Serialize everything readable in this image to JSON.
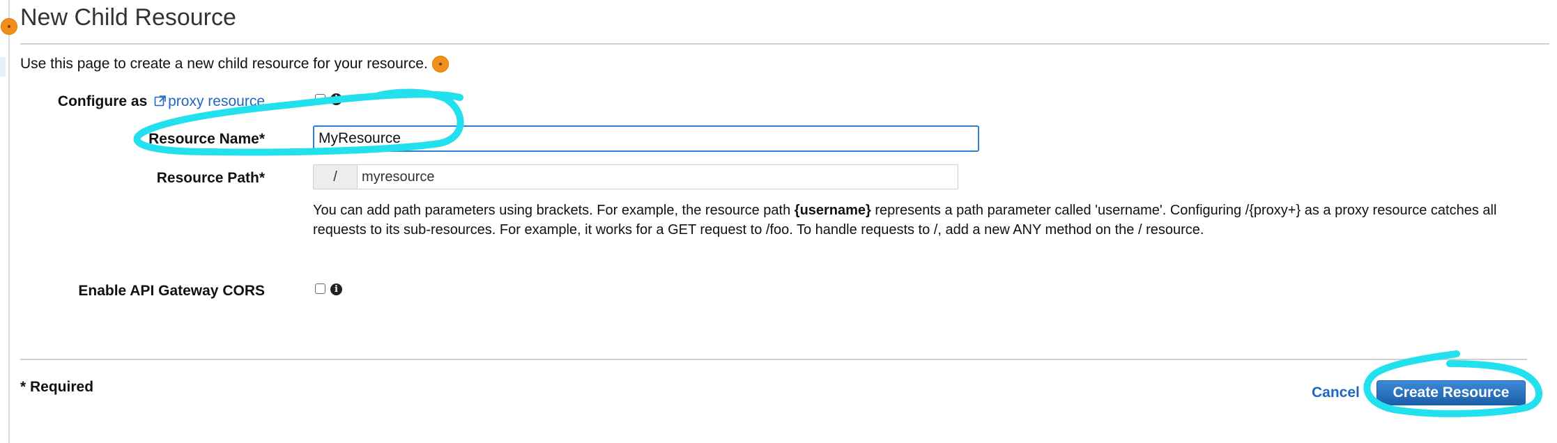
{
  "page": {
    "title": "New Child Resource",
    "intro": "Use this page to create a new child resource for your resource.",
    "accent_color": "#f0901a",
    "link_color": "#1f66c2",
    "highlight_color": "#22e0ee"
  },
  "form": {
    "configure_as_label": "Configure as",
    "proxy_link_text": "proxy resource",
    "proxy_checked": false,
    "resource_name_label": "Resource Name*",
    "resource_name_value": "MyResource",
    "resource_path_label": "Resource Path*",
    "resource_path_prefix": "/",
    "resource_path_value": "myresource",
    "help_text_before": "You can add path parameters using brackets. For example, the resource path ",
    "help_text_bold": "{username}",
    "help_text_after": " represents a path parameter called 'username'. Configuring /{proxy+} as a proxy resource catches all requests to its sub-resources. For example, it works for a GET request to /foo. To handle requests to /, add a new ANY method on the / resource.",
    "cors_label": "Enable API Gateway CORS",
    "cors_checked": false,
    "info_icon": "info-icon",
    "external_link_icon": "external-link-icon"
  },
  "footer": {
    "required_note": "* Required",
    "cancel_label": "Cancel",
    "create_label": "Create Resource"
  }
}
